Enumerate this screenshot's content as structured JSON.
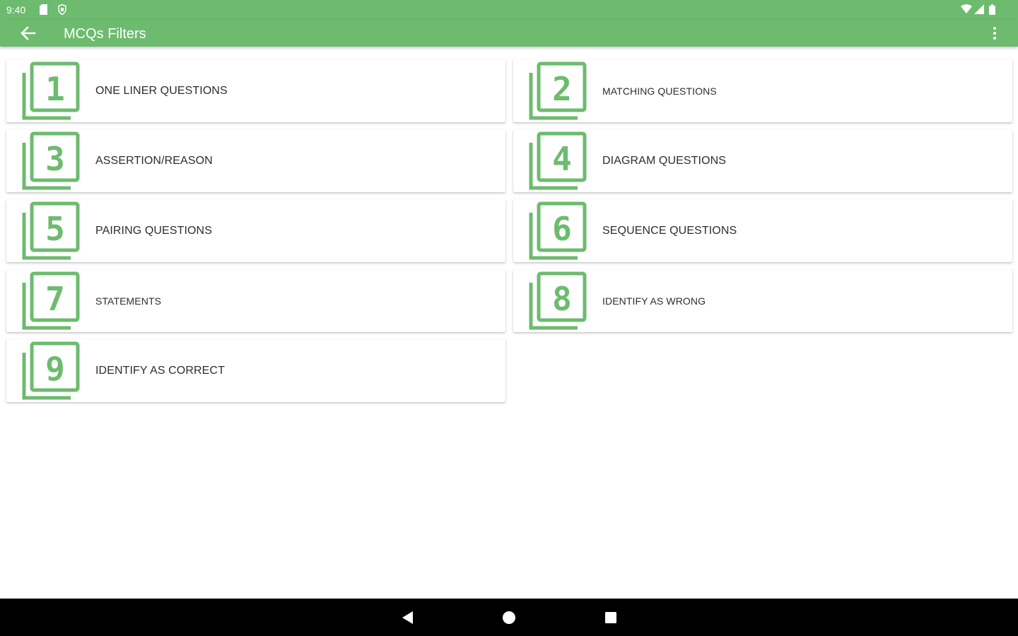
{
  "status_bar": {
    "time": "9:40",
    "icons": [
      "sd-card-icon",
      "shield-icon",
      "wifi-icon",
      "cell-signal-icon",
      "battery-icon"
    ]
  },
  "app_bar": {
    "title": "MCQs Filters",
    "back_icon": "arrow-back-icon",
    "menu_icon": "more-vert-icon"
  },
  "filters": [
    {
      "number": "1",
      "label": "ONE LINER QUESTIONS"
    },
    {
      "number": "2",
      "label": "MATCHING QUESTIONS"
    },
    {
      "number": "3",
      "label": "ASSERTION/REASON"
    },
    {
      "number": "4",
      "label": "DIAGRAM QUESTIONS"
    },
    {
      "number": "5",
      "label": "PAIRING QUESTIONS"
    },
    {
      "number": "6",
      "label": "SEQUENCE QUESTIONS"
    },
    {
      "number": "7",
      "label": "STATEMENTS"
    },
    {
      "number": "8",
      "label": "IDENTIFY AS WRONG"
    },
    {
      "number": "9",
      "label": "IDENTIFY AS CORRECT"
    }
  ],
  "nav_bar": {
    "icons": [
      "nav-back-icon",
      "nav-home-icon",
      "nav-recents-icon"
    ]
  },
  "colors": {
    "primary": "#6dbb6f",
    "icon_green": "#6dbb6f",
    "text": "#2d2d2d",
    "nav_bar": "#000000"
  }
}
